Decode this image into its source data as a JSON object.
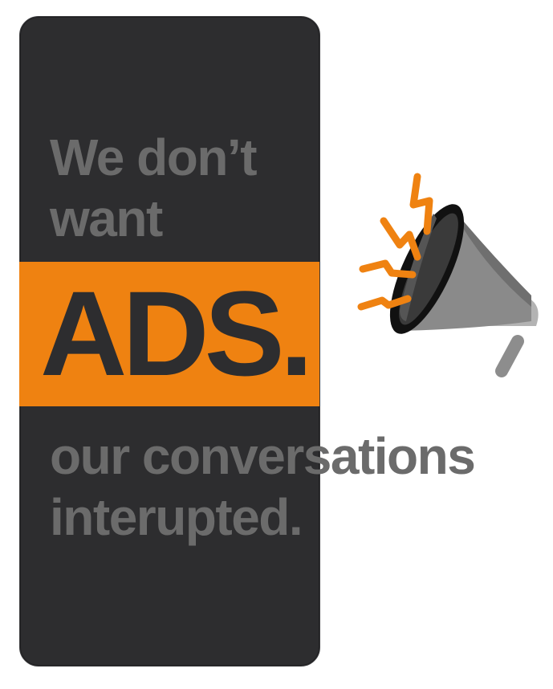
{
  "headline": {
    "line1": "We don’t",
    "line2": "want",
    "emphasis": "ADS.",
    "line3": "our conversations",
    "line4": "interupted."
  },
  "colors": {
    "card_background": "#2d2d2f",
    "accent_orange": "#ef8211",
    "muted_text": "#6b6b6b",
    "emphasis_text": "#2d2d2f"
  },
  "icons": {
    "megaphone": "megaphone-icon"
  }
}
